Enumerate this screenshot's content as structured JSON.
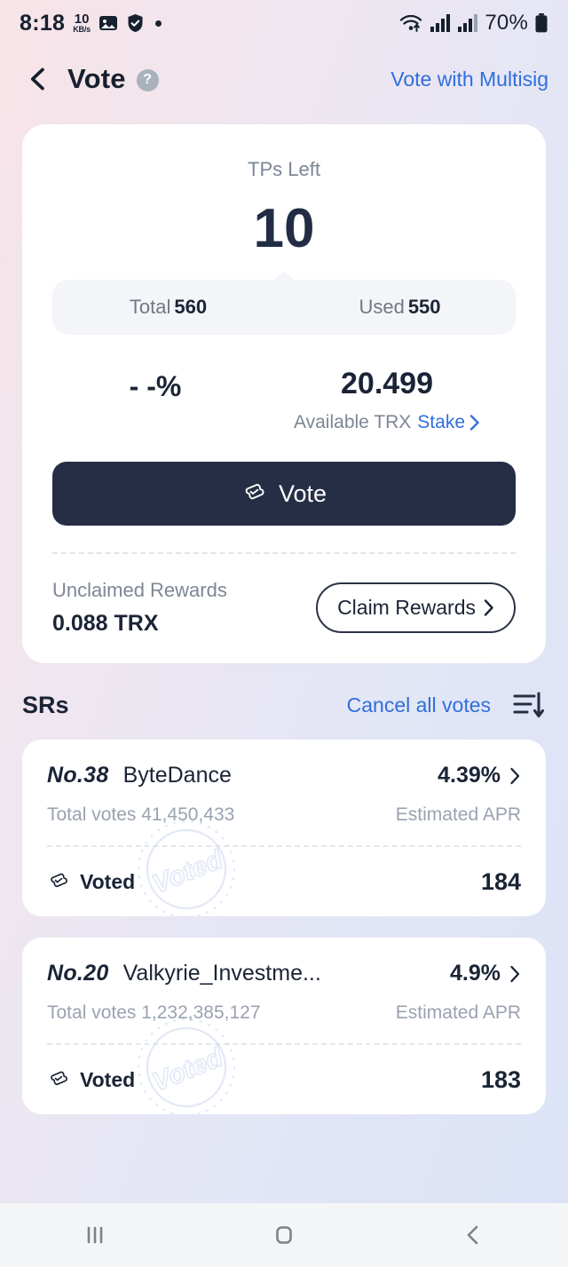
{
  "status_bar": {
    "time": "8:18",
    "net_speed_value": "10",
    "net_speed_unit": "KB/s",
    "icons": [
      "image-icon",
      "shield-icon",
      "dot-indicator",
      "wifi-icon",
      "signal-icon",
      "signal-icon-2"
    ],
    "battery_percent": "70%"
  },
  "header": {
    "back_icon": "chevron-left-icon",
    "title": "Vote",
    "help_icon_label": "?",
    "multisig_link": "Vote with Multisig"
  },
  "summary_card": {
    "tps_label": "TPs Left",
    "tps_value": "10",
    "total_label": "Total",
    "total_value": "560",
    "used_label": "Used",
    "used_value": "550",
    "percent_value": "- -%",
    "available_amount": "20.499",
    "available_label": "Available TRX",
    "stake_link": "Stake",
    "vote_button": "Vote",
    "unclaimed_label": "Unclaimed Rewards",
    "unclaimed_value": "0.088 TRX",
    "claim_button": "Claim Rewards"
  },
  "srs_section": {
    "title": "SRs",
    "cancel_link": "Cancel all votes",
    "sort_icon": "sort-descending-icon",
    "items": [
      {
        "rank": "No.38",
        "name": "ByteDance",
        "apr": "4.39%",
        "total_votes": "Total votes 41,450,433",
        "apr_label": "Estimated APR",
        "voted_label": "Voted",
        "vote_count": "184",
        "watermark": "Voted"
      },
      {
        "rank": "No.20",
        "name": "Valkyrie_Investme...",
        "apr": "4.9%",
        "total_votes": "Total votes 1,232,385,127",
        "apr_label": "Estimated APR",
        "voted_label": "Voted",
        "vote_count": "183",
        "watermark": "Voted"
      }
    ]
  },
  "nav_bar": {
    "recents": "recents-icon",
    "home": "home-icon",
    "back": "back-icon"
  },
  "colors": {
    "accent_blue": "#2f6fdc",
    "dark_navy": "#252e45",
    "muted_gray": "#7d8696"
  }
}
